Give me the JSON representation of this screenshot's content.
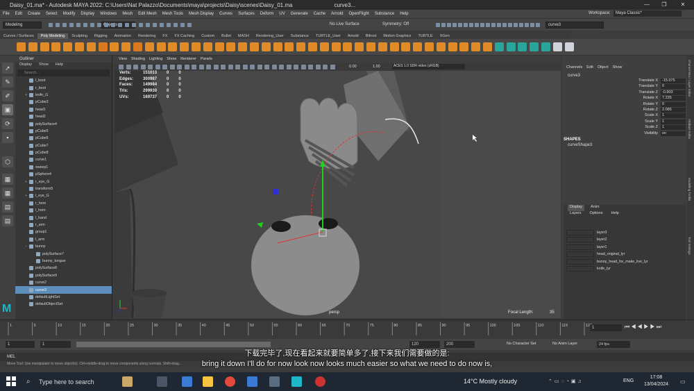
{
  "window": {
    "title": "Daisy_01.ma* - Autodesk MAYA 2022: C:\\Users\\Nat Palazzo\\Documents\\maya\\projects\\Daisy\\scenes\\Daisy_01.ma",
    "tab": "curve3..."
  },
  "menu": [
    "File",
    "Edit",
    "Create",
    "Select",
    "Modify",
    "Display",
    "Windows",
    "Mesh",
    "Edit Mesh",
    "Mesh Tools",
    "Mesh Display",
    "Curves",
    "Surfaces",
    "Deform",
    "UV",
    "Generate",
    "Cache",
    "Arnold",
    "OpenFlight",
    "Substance",
    "Help"
  ],
  "workspace": {
    "label": "Workspace:",
    "value": "Maya Classic*"
  },
  "status": {
    "mode": "Modeling",
    "objects": "Objects",
    "live": "No Live Surface",
    "symmetry": "Symmetry: Off",
    "search": "curve3"
  },
  "shelf_tabs": [
    "Curves / Surfaces",
    "Poly Modeling",
    "Sculpting",
    "Rigging",
    "Animation",
    "Rendering",
    "FX",
    "FX Caching",
    "Custom",
    "Bullet",
    "MASH",
    "Rendering_User",
    "Substance",
    "TURTLE_User",
    "Arnold",
    "Bifrost",
    "Motion Graphics",
    "TURTLE",
    "XGen"
  ],
  "active_shelf": "Poly Modeling",
  "outliner": {
    "title": "Outliner",
    "menu": [
      "Display",
      "Show",
      "Help"
    ],
    "search": "Search...",
    "items": [
      {
        "name": "l_boot",
        "exp": "",
        "indent": 1
      },
      {
        "name": "r_boot",
        "exp": "",
        "indent": 1
      },
      {
        "name": "knife_G",
        "exp": "+",
        "indent": 1
      },
      {
        "name": "pCube3",
        "exp": "",
        "indent": 1
      },
      {
        "name": "head1",
        "exp": "",
        "indent": 1
      },
      {
        "name": "head2",
        "exp": "",
        "indent": 1
      },
      {
        "name": "polySurface4",
        "exp": "",
        "indent": 1
      },
      {
        "name": "pCube5",
        "exp": "",
        "indent": 1
      },
      {
        "name": "pCube6",
        "exp": "",
        "indent": 1
      },
      {
        "name": "pCube7",
        "exp": "",
        "indent": 1
      },
      {
        "name": "pCube8",
        "exp": "",
        "indent": 1
      },
      {
        "name": "curve1",
        "exp": "",
        "indent": 1
      },
      {
        "name": "sweep1",
        "exp": "",
        "indent": 1
      },
      {
        "name": "pSphere4",
        "exp": "",
        "indent": 1
      },
      {
        "name": "r_eye_G",
        "exp": "+",
        "indent": 1
      },
      {
        "name": "transform5",
        "exp": "",
        "indent": 1
      },
      {
        "name": "l_eye_G",
        "exp": "+",
        "indent": 1
      },
      {
        "name": "r_horn",
        "exp": "",
        "indent": 1
      },
      {
        "name": "l_horn",
        "exp": "",
        "indent": 1
      },
      {
        "name": "l_hand",
        "exp": "",
        "indent": 1
      },
      {
        "name": "r_arm",
        "exp": "",
        "indent": 1
      },
      {
        "name": "group1",
        "exp": "",
        "indent": 1
      },
      {
        "name": "l_arm",
        "exp": "",
        "indent": 1
      },
      {
        "name": "bunny",
        "exp": "−",
        "indent": 1
      },
      {
        "name": "polySurface7",
        "exp": "",
        "indent": 2
      },
      {
        "name": "bunny_tongue",
        "exp": "",
        "indent": 2
      },
      {
        "name": "polySurface8",
        "exp": "",
        "indent": 1
      },
      {
        "name": "polySurface9",
        "exp": "",
        "indent": 1
      },
      {
        "name": "curve2",
        "exp": "",
        "indent": 1
      },
      {
        "name": "curve3",
        "exp": "",
        "indent": 1,
        "selected": true
      },
      {
        "name": "defaultLightSet",
        "exp": "",
        "indent": 1
      },
      {
        "name": "defaultObjectSet",
        "exp": "",
        "indent": 1
      }
    ]
  },
  "viewport": {
    "menu": [
      "View",
      "Shading",
      "Lighting",
      "Show",
      "Renderer",
      "Panels"
    ],
    "exposure": "0.00",
    "gamma": "1.00",
    "colorspace": "ACES 1.0 SDR-video (sRGB)",
    "hud": [
      {
        "label": "Verts:",
        "a": "151013",
        "b": "0",
        "c": "0"
      },
      {
        "label": "Edges:",
        "a": "300987",
        "b": "0",
        "c": "0"
      },
      {
        "label": "Faces:",
        "a": "149984",
        "b": "0",
        "c": "0"
      },
      {
        "label": "Tris:",
        "a": "299930",
        "b": "0",
        "c": "0"
      },
      {
        "label": "UVs:",
        "a": "169737",
        "b": "0",
        "c": "0"
      }
    ],
    "camera": "persp",
    "focal_label": "Focal Length:",
    "focal_value": "35"
  },
  "channelbox": {
    "menu": [
      "Channels",
      "Edit",
      "Object",
      "Show"
    ],
    "object": "curve3",
    "attrs": [
      {
        "name": "Translate X",
        "value": "-15.075"
      },
      {
        "name": "Translate Y",
        "value": "0"
      },
      {
        "name": "Translate Z",
        "value": "-0.903"
      },
      {
        "name": "Rotate X",
        "value": "7.235"
      },
      {
        "name": "Rotate Y",
        "value": "0"
      },
      {
        "name": "Rotate Z",
        "value": "2.086"
      },
      {
        "name": "Scale X",
        "value": "1"
      },
      {
        "name": "Scale Y",
        "value": "1"
      },
      {
        "name": "Scale Z",
        "value": "1"
      },
      {
        "name": "Visibility",
        "value": "on"
      }
    ],
    "shapes_label": "SHAPES",
    "shape": "curveShape3"
  },
  "layers": {
    "tabs": [
      "Display",
      "Anim"
    ],
    "menu": [
      "Layers",
      "Options",
      "Help"
    ],
    "items": [
      "layer3",
      "layer2",
      "layer1",
      "head_original_lyr",
      "bunny_head_for_make_live_lyr",
      "knife_lyr"
    ]
  },
  "side_tabs": [
    "Channel Box / Layer Editor",
    "Attribute Editor",
    "Modelling Toolkit",
    "Tool Settings"
  ],
  "timeline": {
    "ticks": [
      "1",
      "5",
      "10",
      "15",
      "20",
      "25",
      "30",
      "35",
      "40",
      "45",
      "50",
      "55",
      "60",
      "65",
      "70",
      "75",
      "80",
      "85",
      "90",
      "95",
      "100",
      "105",
      "110",
      "115",
      "120"
    ],
    "current": "1",
    "start": "1",
    "range_start": "1",
    "range_end": "120",
    "end_a": "120",
    "end_b": "200",
    "char_set": "No Character Set",
    "anim_layer": "No Anim Layer",
    "fps": "24 fps"
  },
  "cmd": {
    "label": "MEL"
  },
  "helpline": "Move Tool: Use manipulator to move object(s). Ctrl+middle-drag to move components along normals. Shift+drag...",
  "subtitles": {
    "zh": "下载完毕了,现在看起来就要简单多了,接下来我们需要做的是:",
    "en": "bring it down I'll do for now look now looks much easier so what we need to do now is,"
  },
  "taskbar": {
    "search": "Type here to search",
    "weather": "14°C  Mostly cloudy",
    "lang": "ENG",
    "time": "17:08",
    "date": "13/04/2024"
  }
}
